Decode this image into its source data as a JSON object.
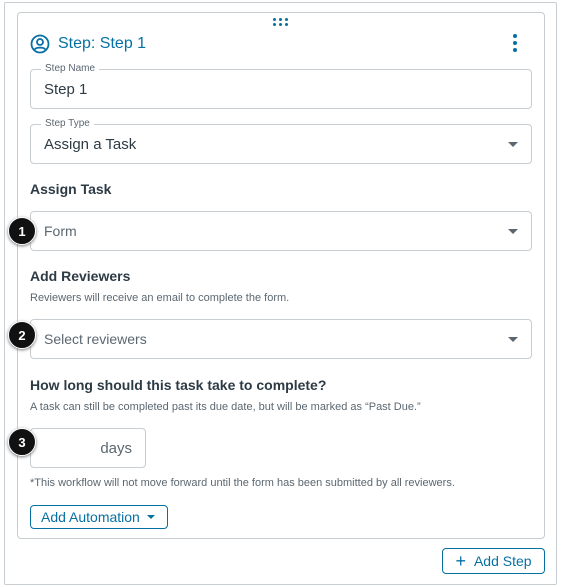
{
  "step": {
    "title": "Step: Step 1",
    "name_label": "Step Name",
    "name_value": "Step 1",
    "type_label": "Step Type",
    "type_value": "Assign a Task"
  },
  "assign_task": {
    "heading": "Assign Task",
    "select_value": "Form"
  },
  "reviewers": {
    "heading": "Add Reviewers",
    "helper": "Reviewers will receive an email to complete the form.",
    "placeholder": "Select reviewers"
  },
  "duration": {
    "heading": "How long should this task take to complete?",
    "helper": "A task can still be completed past its due date, but will be marked as “Past Due.”",
    "unit": "days",
    "note": "*This workflow will not move forward until the form has been submitted by all reviewers."
  },
  "actions": {
    "add_automation": "Add Automation",
    "add_step": "Add Step",
    "add_step_icon": "+"
  },
  "callouts": [
    "1",
    "2",
    "3"
  ],
  "colors": {
    "accent": "#0770a3",
    "border": "#c7cdd1",
    "text": "#2d3b45",
    "muted": "#5b6770"
  },
  "icons": [
    "drag-handle-icon",
    "user-circle-icon",
    "kebab-menu-icon",
    "chevron-down-icon",
    "plus-icon"
  ]
}
